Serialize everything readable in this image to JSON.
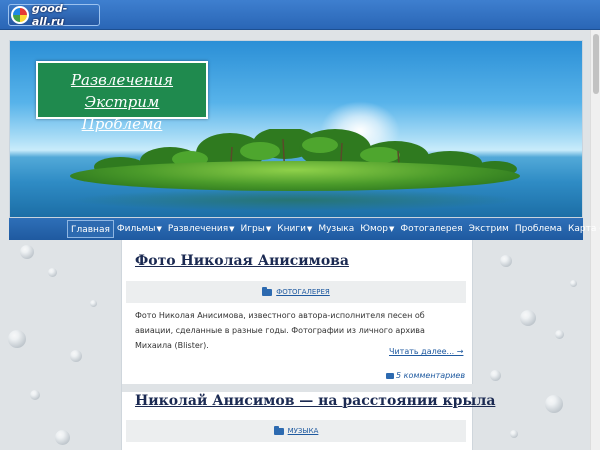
{
  "logo": {
    "text": "good-all.ru"
  },
  "header": {
    "title_line1": "Развлечения Экстрим",
    "title_line2": "Проблема"
  },
  "nav": {
    "items": [
      {
        "label": "Главная",
        "active": true,
        "caret": false
      },
      {
        "label": "Фильмы",
        "caret": true
      },
      {
        "label": "Развлечения",
        "caret": true
      },
      {
        "label": "Игры",
        "caret": true
      },
      {
        "label": "Книги",
        "caret": true
      },
      {
        "label": "Музыка",
        "caret": false
      },
      {
        "label": "Юмор",
        "caret": true
      },
      {
        "label": "Фотогалерея",
        "caret": false
      },
      {
        "label": "Экстрим",
        "caret": false
      },
      {
        "label": "Проблема",
        "caret": false
      },
      {
        "label": "Карта сайта",
        "caret": false
      }
    ]
  },
  "posts": [
    {
      "title": "Фото Николая Анисимова",
      "category": "ФОТОГАЛЕРЕЯ",
      "excerpt": "Фото Николая Анисимова, известного автора-исполнителя песен об авиации, сделанные в разные годы. Фотографии из личного архива Михаила (Blister).",
      "read_more": "Читать далее... →",
      "comments": "5 комментариев"
    },
    {
      "title": "Николай Анисимов — на расстоянии крыла",
      "category": "МУЗЫКА"
    }
  ],
  "icons": {
    "category": "folder-icon",
    "comments": "comment-icon",
    "logo": "globe-icon"
  },
  "colors": {
    "topbar": "#2a66b6",
    "nav": "#1f5aa0",
    "title_box": "#1f8a4e",
    "link": "#1f5aa0",
    "post_title": "#1b2a52"
  }
}
